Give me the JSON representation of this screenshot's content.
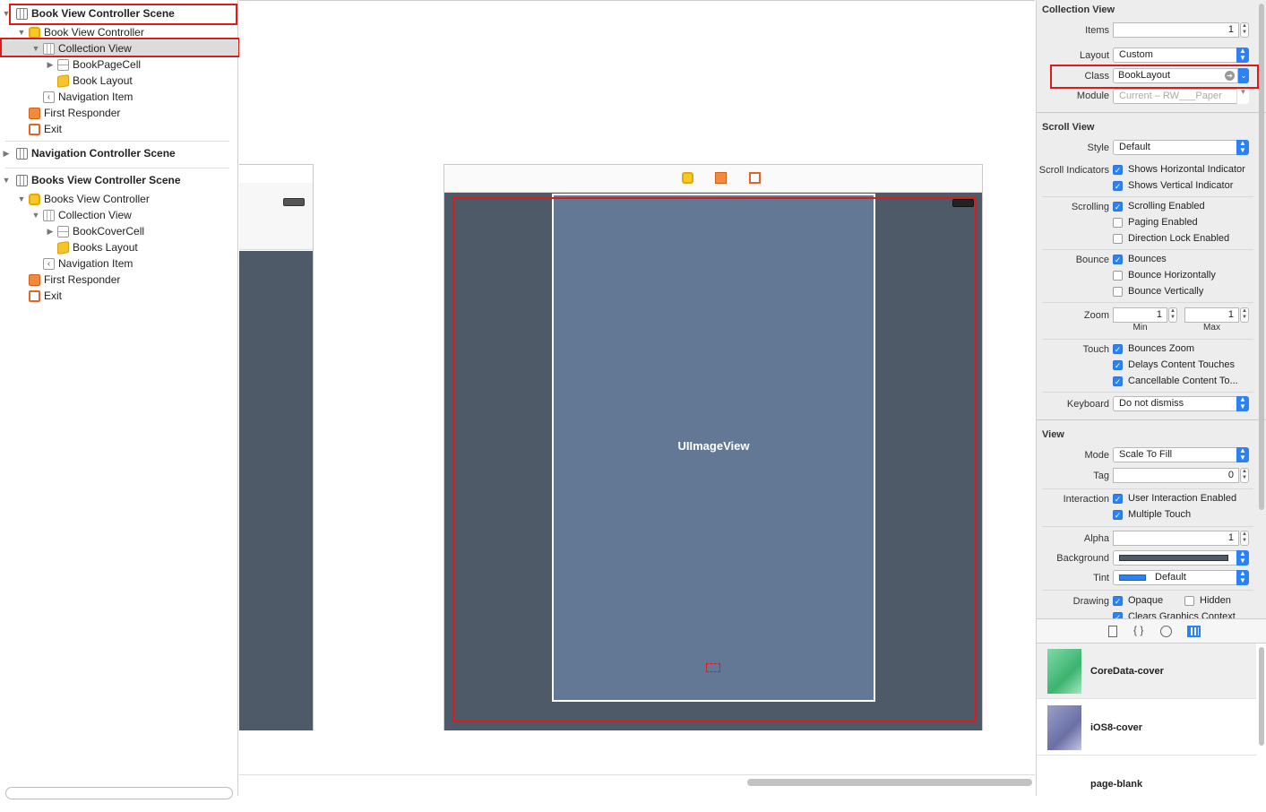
{
  "outline": {
    "scene1": {
      "title": "Book View Controller Scene",
      "controller": "Book View Controller",
      "collection_view": "Collection View",
      "cell": "BookPageCell",
      "layout": "Book Layout",
      "nav_item": "Navigation Item",
      "first_responder": "First Responder",
      "exit": "Exit"
    },
    "scene2": {
      "title": "Navigation Controller Scene"
    },
    "scene3": {
      "title": "Books View Controller Scene",
      "controller": "Books View Controller",
      "collection_view": "Collection View",
      "cell": "BookCoverCell",
      "layout": "Books Layout",
      "nav_item": "Navigation Item",
      "first_responder": "First Responder",
      "exit": "Exit"
    }
  },
  "canvas": {
    "image_view_label": "UIImageView"
  },
  "inspector": {
    "collection_view": {
      "title": "Collection View",
      "items_label": "Items",
      "items_value": "1",
      "layout_label": "Layout",
      "layout_value": "Custom",
      "class_label": "Class",
      "class_value": "BookLayout",
      "module_label": "Module",
      "module_placeholder": "Current – RW___Paper"
    },
    "scroll_view": {
      "title": "Scroll View",
      "style_label": "Style",
      "style_value": "Default",
      "indicators_label": "Scroll Indicators",
      "shows_horizontal": "Shows Horizontal Indicator",
      "shows_vertical": "Shows Vertical Indicator",
      "scrolling_label": "Scrolling",
      "scrolling_enabled": "Scrolling Enabled",
      "paging_enabled": "Paging Enabled",
      "direction_lock": "Direction Lock Enabled",
      "bounce_label": "Bounce",
      "bounces": "Bounces",
      "bounce_h": "Bounce Horizontally",
      "bounce_v": "Bounce Vertically",
      "zoom_label": "Zoom",
      "zoom_min": "1",
      "zoom_max": "1",
      "min_label": "Min",
      "max_label": "Max",
      "touch_label": "Touch",
      "bounces_zoom": "Bounces Zoom",
      "delays_touches": "Delays Content Touches",
      "cancellable": "Cancellable Content To...",
      "keyboard_label": "Keyboard",
      "keyboard_value": "Do not dismiss"
    },
    "view": {
      "title": "View",
      "mode_label": "Mode",
      "mode_value": "Scale To Fill",
      "tag_label": "Tag",
      "tag_value": "0",
      "interaction_label": "Interaction",
      "user_interaction": "User Interaction Enabled",
      "multiple_touch": "Multiple Touch",
      "alpha_label": "Alpha",
      "alpha_value": "1",
      "background_label": "Background",
      "tint_label": "Tint",
      "tint_value": "Default",
      "drawing_label": "Drawing",
      "opaque": "Opaque",
      "hidden": "Hidden",
      "clears_graphics": "Clears Graphics Context"
    },
    "colors": {
      "accent": "#2c82f5",
      "highlight": "#e0191b"
    }
  },
  "library": {
    "items": [
      {
        "name": "CoreData-cover"
      },
      {
        "name": "iOS8-cover"
      },
      {
        "name": "page-blank"
      }
    ]
  }
}
